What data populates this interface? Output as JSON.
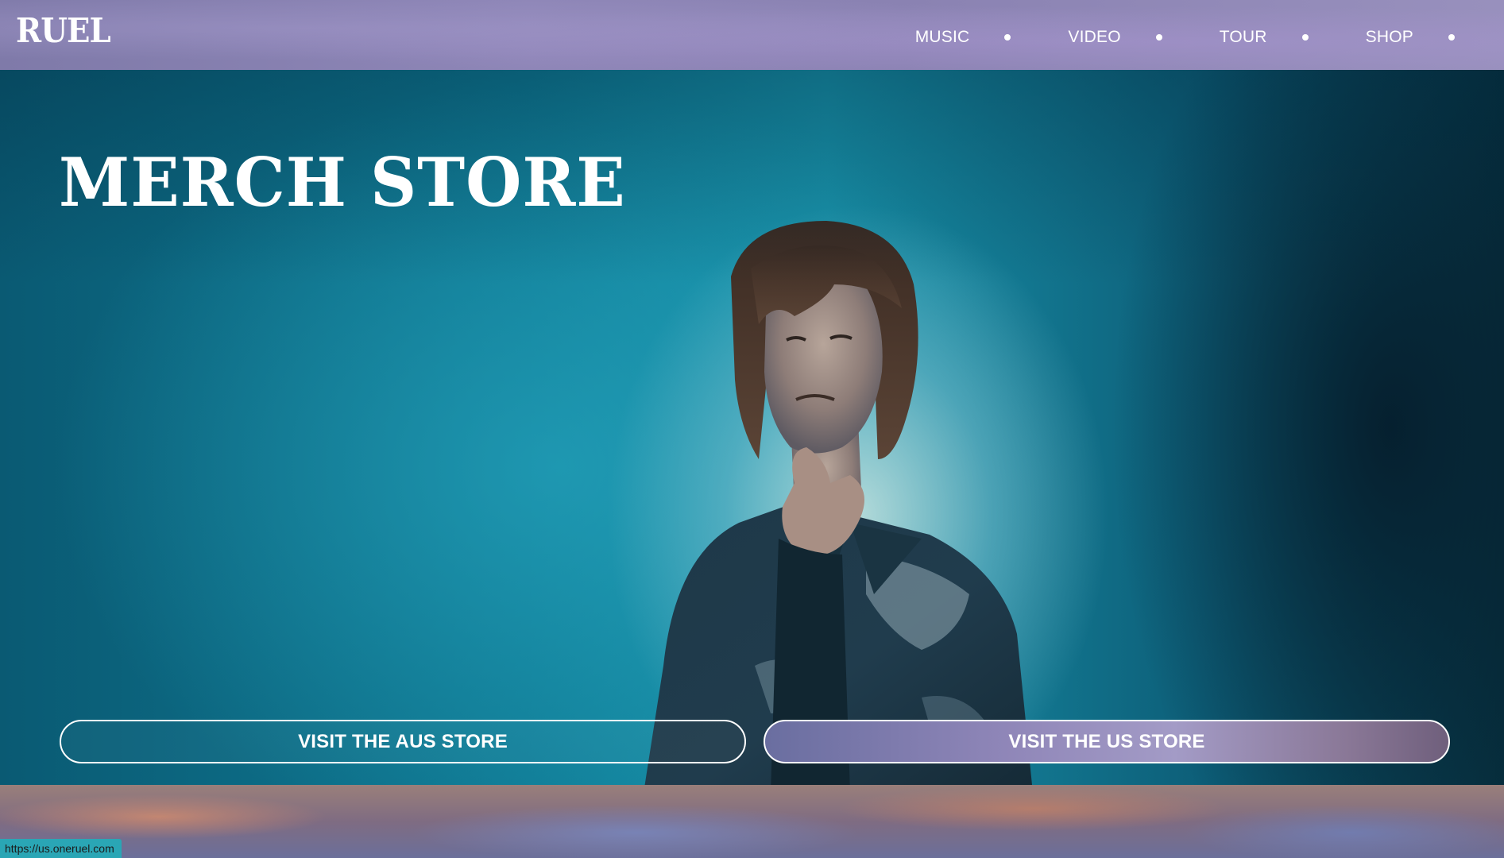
{
  "header": {
    "logo": "RUEL",
    "nav": [
      {
        "label": "MUSIC"
      },
      {
        "label": "VIDEO"
      },
      {
        "label": "TOUR"
      },
      {
        "label": "SHOP"
      }
    ]
  },
  "hero": {
    "title": "MERCH STORE",
    "buttons": {
      "aus_label": "VISIT THE AUS STORE",
      "us_label": "VISIT THE US STORE"
    }
  },
  "status_bar": {
    "url": "https://us.oneruel.com"
  },
  "colors": {
    "header_bg": "#8e86b7",
    "hero_bg": "#0f7a94",
    "status_bg": "#2aa6b5",
    "text": "#ffffff"
  }
}
